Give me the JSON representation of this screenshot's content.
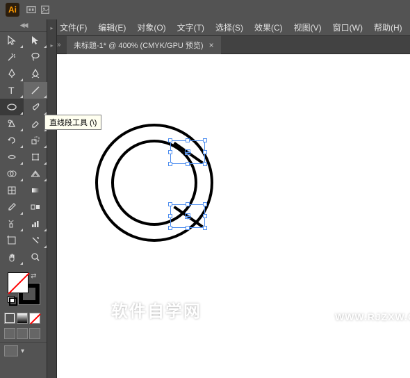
{
  "app": {
    "logo_text": "Ai"
  },
  "menu": {
    "items": [
      "文件(F)",
      "编辑(E)",
      "对象(O)",
      "文字(T)",
      "选择(S)",
      "效果(C)",
      "视图(V)",
      "窗口(W)",
      "帮助(H)"
    ]
  },
  "tab": {
    "title": "未标题-1* @ 400% (CMYK/GPU 预览)",
    "close": "×"
  },
  "tooltip": {
    "text": "直线段工具 (\\)"
  },
  "watermark": {
    "main": "软件自学网",
    "sub": "WWW.RJZXW.COM"
  },
  "toolbox_strip": {
    "chev1": "▸",
    "chev2": "▸"
  },
  "tabbar": {
    "chev": "»"
  },
  "collapse": {
    "arrows": "◀◀"
  }
}
